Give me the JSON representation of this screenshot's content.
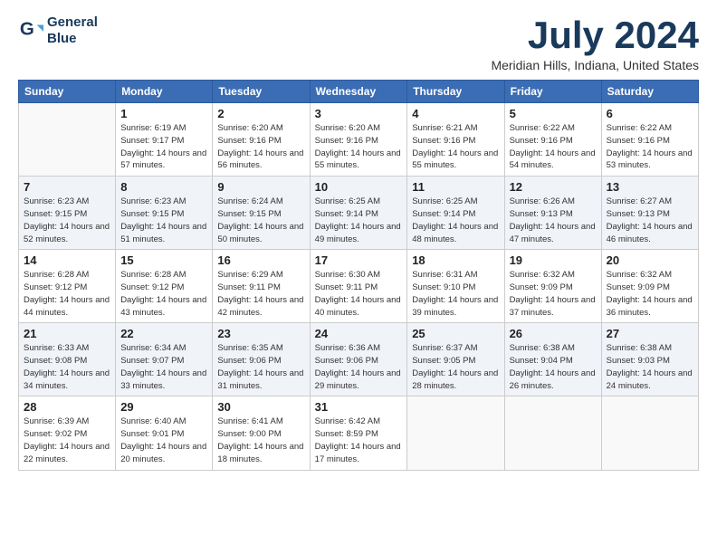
{
  "logo": {
    "line1": "General",
    "line2": "Blue"
  },
  "title": "July 2024",
  "subtitle": "Meridian Hills, Indiana, United States",
  "weekdays": [
    "Sunday",
    "Monday",
    "Tuesday",
    "Wednesday",
    "Thursday",
    "Friday",
    "Saturday"
  ],
  "weeks": [
    [
      {
        "day": "",
        "sunrise": "",
        "sunset": "",
        "daylight": ""
      },
      {
        "day": "1",
        "sunrise": "Sunrise: 6:19 AM",
        "sunset": "Sunset: 9:17 PM",
        "daylight": "Daylight: 14 hours and 57 minutes."
      },
      {
        "day": "2",
        "sunrise": "Sunrise: 6:20 AM",
        "sunset": "Sunset: 9:16 PM",
        "daylight": "Daylight: 14 hours and 56 minutes."
      },
      {
        "day": "3",
        "sunrise": "Sunrise: 6:20 AM",
        "sunset": "Sunset: 9:16 PM",
        "daylight": "Daylight: 14 hours and 55 minutes."
      },
      {
        "day": "4",
        "sunrise": "Sunrise: 6:21 AM",
        "sunset": "Sunset: 9:16 PM",
        "daylight": "Daylight: 14 hours and 55 minutes."
      },
      {
        "day": "5",
        "sunrise": "Sunrise: 6:22 AM",
        "sunset": "Sunset: 9:16 PM",
        "daylight": "Daylight: 14 hours and 54 minutes."
      },
      {
        "day": "6",
        "sunrise": "Sunrise: 6:22 AM",
        "sunset": "Sunset: 9:16 PM",
        "daylight": "Daylight: 14 hours and 53 minutes."
      }
    ],
    [
      {
        "day": "7",
        "sunrise": "Sunrise: 6:23 AM",
        "sunset": "Sunset: 9:15 PM",
        "daylight": "Daylight: 14 hours and 52 minutes."
      },
      {
        "day": "8",
        "sunrise": "Sunrise: 6:23 AM",
        "sunset": "Sunset: 9:15 PM",
        "daylight": "Daylight: 14 hours and 51 minutes."
      },
      {
        "day": "9",
        "sunrise": "Sunrise: 6:24 AM",
        "sunset": "Sunset: 9:15 PM",
        "daylight": "Daylight: 14 hours and 50 minutes."
      },
      {
        "day": "10",
        "sunrise": "Sunrise: 6:25 AM",
        "sunset": "Sunset: 9:14 PM",
        "daylight": "Daylight: 14 hours and 49 minutes."
      },
      {
        "day": "11",
        "sunrise": "Sunrise: 6:25 AM",
        "sunset": "Sunset: 9:14 PM",
        "daylight": "Daylight: 14 hours and 48 minutes."
      },
      {
        "day": "12",
        "sunrise": "Sunrise: 6:26 AM",
        "sunset": "Sunset: 9:13 PM",
        "daylight": "Daylight: 14 hours and 47 minutes."
      },
      {
        "day": "13",
        "sunrise": "Sunrise: 6:27 AM",
        "sunset": "Sunset: 9:13 PM",
        "daylight": "Daylight: 14 hours and 46 minutes."
      }
    ],
    [
      {
        "day": "14",
        "sunrise": "Sunrise: 6:28 AM",
        "sunset": "Sunset: 9:12 PM",
        "daylight": "Daylight: 14 hours and 44 minutes."
      },
      {
        "day": "15",
        "sunrise": "Sunrise: 6:28 AM",
        "sunset": "Sunset: 9:12 PM",
        "daylight": "Daylight: 14 hours and 43 minutes."
      },
      {
        "day": "16",
        "sunrise": "Sunrise: 6:29 AM",
        "sunset": "Sunset: 9:11 PM",
        "daylight": "Daylight: 14 hours and 42 minutes."
      },
      {
        "day": "17",
        "sunrise": "Sunrise: 6:30 AM",
        "sunset": "Sunset: 9:11 PM",
        "daylight": "Daylight: 14 hours and 40 minutes."
      },
      {
        "day": "18",
        "sunrise": "Sunrise: 6:31 AM",
        "sunset": "Sunset: 9:10 PM",
        "daylight": "Daylight: 14 hours and 39 minutes."
      },
      {
        "day": "19",
        "sunrise": "Sunrise: 6:32 AM",
        "sunset": "Sunset: 9:09 PM",
        "daylight": "Daylight: 14 hours and 37 minutes."
      },
      {
        "day": "20",
        "sunrise": "Sunrise: 6:32 AM",
        "sunset": "Sunset: 9:09 PM",
        "daylight": "Daylight: 14 hours and 36 minutes."
      }
    ],
    [
      {
        "day": "21",
        "sunrise": "Sunrise: 6:33 AM",
        "sunset": "Sunset: 9:08 PM",
        "daylight": "Daylight: 14 hours and 34 minutes."
      },
      {
        "day": "22",
        "sunrise": "Sunrise: 6:34 AM",
        "sunset": "Sunset: 9:07 PM",
        "daylight": "Daylight: 14 hours and 33 minutes."
      },
      {
        "day": "23",
        "sunrise": "Sunrise: 6:35 AM",
        "sunset": "Sunset: 9:06 PM",
        "daylight": "Daylight: 14 hours and 31 minutes."
      },
      {
        "day": "24",
        "sunrise": "Sunrise: 6:36 AM",
        "sunset": "Sunset: 9:06 PM",
        "daylight": "Daylight: 14 hours and 29 minutes."
      },
      {
        "day": "25",
        "sunrise": "Sunrise: 6:37 AM",
        "sunset": "Sunset: 9:05 PM",
        "daylight": "Daylight: 14 hours and 28 minutes."
      },
      {
        "day": "26",
        "sunrise": "Sunrise: 6:38 AM",
        "sunset": "Sunset: 9:04 PM",
        "daylight": "Daylight: 14 hours and 26 minutes."
      },
      {
        "day": "27",
        "sunrise": "Sunrise: 6:38 AM",
        "sunset": "Sunset: 9:03 PM",
        "daylight": "Daylight: 14 hours and 24 minutes."
      }
    ],
    [
      {
        "day": "28",
        "sunrise": "Sunrise: 6:39 AM",
        "sunset": "Sunset: 9:02 PM",
        "daylight": "Daylight: 14 hours and 22 minutes."
      },
      {
        "day": "29",
        "sunrise": "Sunrise: 6:40 AM",
        "sunset": "Sunset: 9:01 PM",
        "daylight": "Daylight: 14 hours and 20 minutes."
      },
      {
        "day": "30",
        "sunrise": "Sunrise: 6:41 AM",
        "sunset": "Sunset: 9:00 PM",
        "daylight": "Daylight: 14 hours and 18 minutes."
      },
      {
        "day": "31",
        "sunrise": "Sunrise: 6:42 AM",
        "sunset": "Sunset: 8:59 PM",
        "daylight": "Daylight: 14 hours and 17 minutes."
      },
      {
        "day": "",
        "sunrise": "",
        "sunset": "",
        "daylight": ""
      },
      {
        "day": "",
        "sunrise": "",
        "sunset": "",
        "daylight": ""
      },
      {
        "day": "",
        "sunrise": "",
        "sunset": "",
        "daylight": ""
      }
    ]
  ]
}
